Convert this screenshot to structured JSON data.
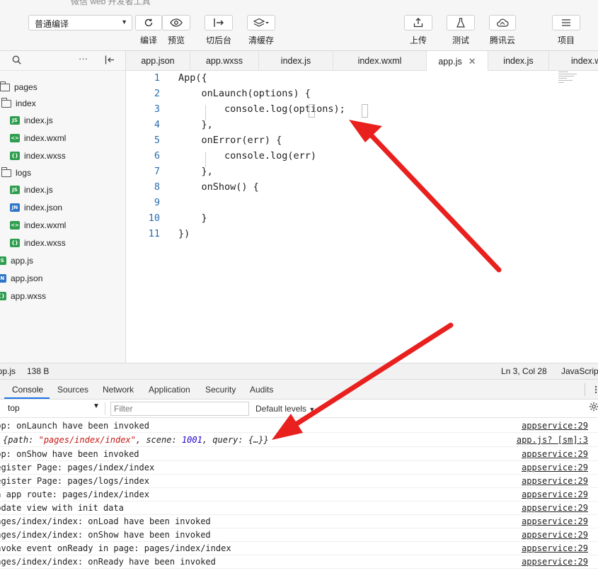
{
  "window": {
    "title_fragment": "微信 web 开发者工具"
  },
  "toolbar": {
    "compile_mode": "普通编译",
    "buttons": [
      {
        "label": "编译",
        "icon": "refresh-icon"
      },
      {
        "label": "预览",
        "icon": "eye-icon"
      },
      {
        "label": "切后台",
        "icon": "switch-background-icon"
      },
      {
        "label": "清缓存",
        "icon": "layers-icon"
      },
      {
        "label": "上传",
        "icon": "upload-icon"
      },
      {
        "label": "测试",
        "icon": "flask-icon"
      },
      {
        "label": "腾讯云",
        "icon": "cloud-icon"
      },
      {
        "label": "项目",
        "icon": "menu-icon"
      }
    ]
  },
  "sidebar": {
    "more": "···",
    "tree": [
      {
        "label": "pages",
        "type": "folder"
      },
      {
        "label": "index",
        "type": "folder"
      },
      {
        "label": "index.js",
        "type": "js",
        "badge": "JS"
      },
      {
        "label": "index.wxml",
        "type": "wxml",
        "badge": "<>"
      },
      {
        "label": "index.wxss",
        "type": "wxss",
        "badge": "{}"
      },
      {
        "label": "logs",
        "type": "folder"
      },
      {
        "label": "index.js",
        "type": "js",
        "badge": "JS"
      },
      {
        "label": "index.json",
        "type": "json",
        "badge": "JN"
      },
      {
        "label": "index.wxml",
        "type": "wxml",
        "badge": "<>"
      },
      {
        "label": "index.wxss",
        "type": "wxss",
        "badge": "{}"
      },
      {
        "label": "app.js",
        "type": "js",
        "badge": "JS"
      },
      {
        "label": "app.json",
        "type": "json",
        "badge": "JN"
      },
      {
        "label": "app.wxss",
        "type": "wxss",
        "badge": "{}"
      }
    ]
  },
  "tabs": [
    {
      "label": "app.json"
    },
    {
      "label": "app.wxss"
    },
    {
      "label": "index.js"
    },
    {
      "label": "index.wxml"
    },
    {
      "label": "app.js",
      "active": true,
      "close": "✕"
    },
    {
      "label": "index.js"
    },
    {
      "label": "index.wxml"
    }
  ],
  "editor": {
    "lines": [
      {
        "n": "1",
        "code": "App({"
      },
      {
        "n": "2",
        "code": "    onLaunch(options) {"
      },
      {
        "n": "3",
        "code": "        console.log(options);"
      },
      {
        "n": "4",
        "code": "    },"
      },
      {
        "n": "5",
        "code": "    onError(err) {"
      },
      {
        "n": "6",
        "code": "        console.log(err)"
      },
      {
        "n": "7",
        "code": "    },"
      },
      {
        "n": "8",
        "code": "    onShow() {"
      },
      {
        "n": "9",
        "code": ""
      },
      {
        "n": "10",
        "code": "    }"
      },
      {
        "n": "11",
        "code": "})"
      }
    ]
  },
  "status": {
    "file": "app.js",
    "size": "138 B",
    "position": "Ln 3, Col 28",
    "language": "JavaScript"
  },
  "devtools": {
    "tabs": [
      "Console",
      "Sources",
      "Network",
      "Application",
      "Security",
      "Audits"
    ],
    "active_tab": "Console",
    "context": "top",
    "filter_placeholder": "Filter",
    "levels": "Default levels",
    "logs": [
      {
        "msg": "App: onLaunch have been invoked",
        "src": "appservice:29"
      },
      {
        "msg": "",
        "src": "app.js? [sm]:3",
        "object": {
          "path": "\"pages/index/index\"",
          "scene": "1001",
          "query": "{…}"
        }
      },
      {
        "msg": "App: onShow have been invoked",
        "src": "appservice:29"
      },
      {
        "msg": "Register Page: pages/index/index",
        "src": "appservice:29"
      },
      {
        "msg": "Register Page: pages/logs/index",
        "src": "appservice:29"
      },
      {
        "msg": "On app route: pages/index/index",
        "src": "appservice:29"
      },
      {
        "msg": "Update view with init data",
        "src": "appservice:29"
      },
      {
        "msg": "pages/index/index: onLoad have been invoked",
        "src": "appservice:29"
      },
      {
        "msg": "pages/index/index: onShow have been invoked",
        "src": "appservice:29"
      },
      {
        "msg": "Invoke event onReady in page: pages/index/index",
        "src": "appservice:29"
      },
      {
        "msg": "pages/index/index: onReady have been invoked",
        "src": "appservice:29"
      }
    ]
  },
  "colors": {
    "accent": "#1a73e8",
    "annotation_arrow": "#e8201e",
    "line_number": "#2b6cb0",
    "file_js": "#2e9d4e",
    "file_json": "#2f76c8"
  }
}
